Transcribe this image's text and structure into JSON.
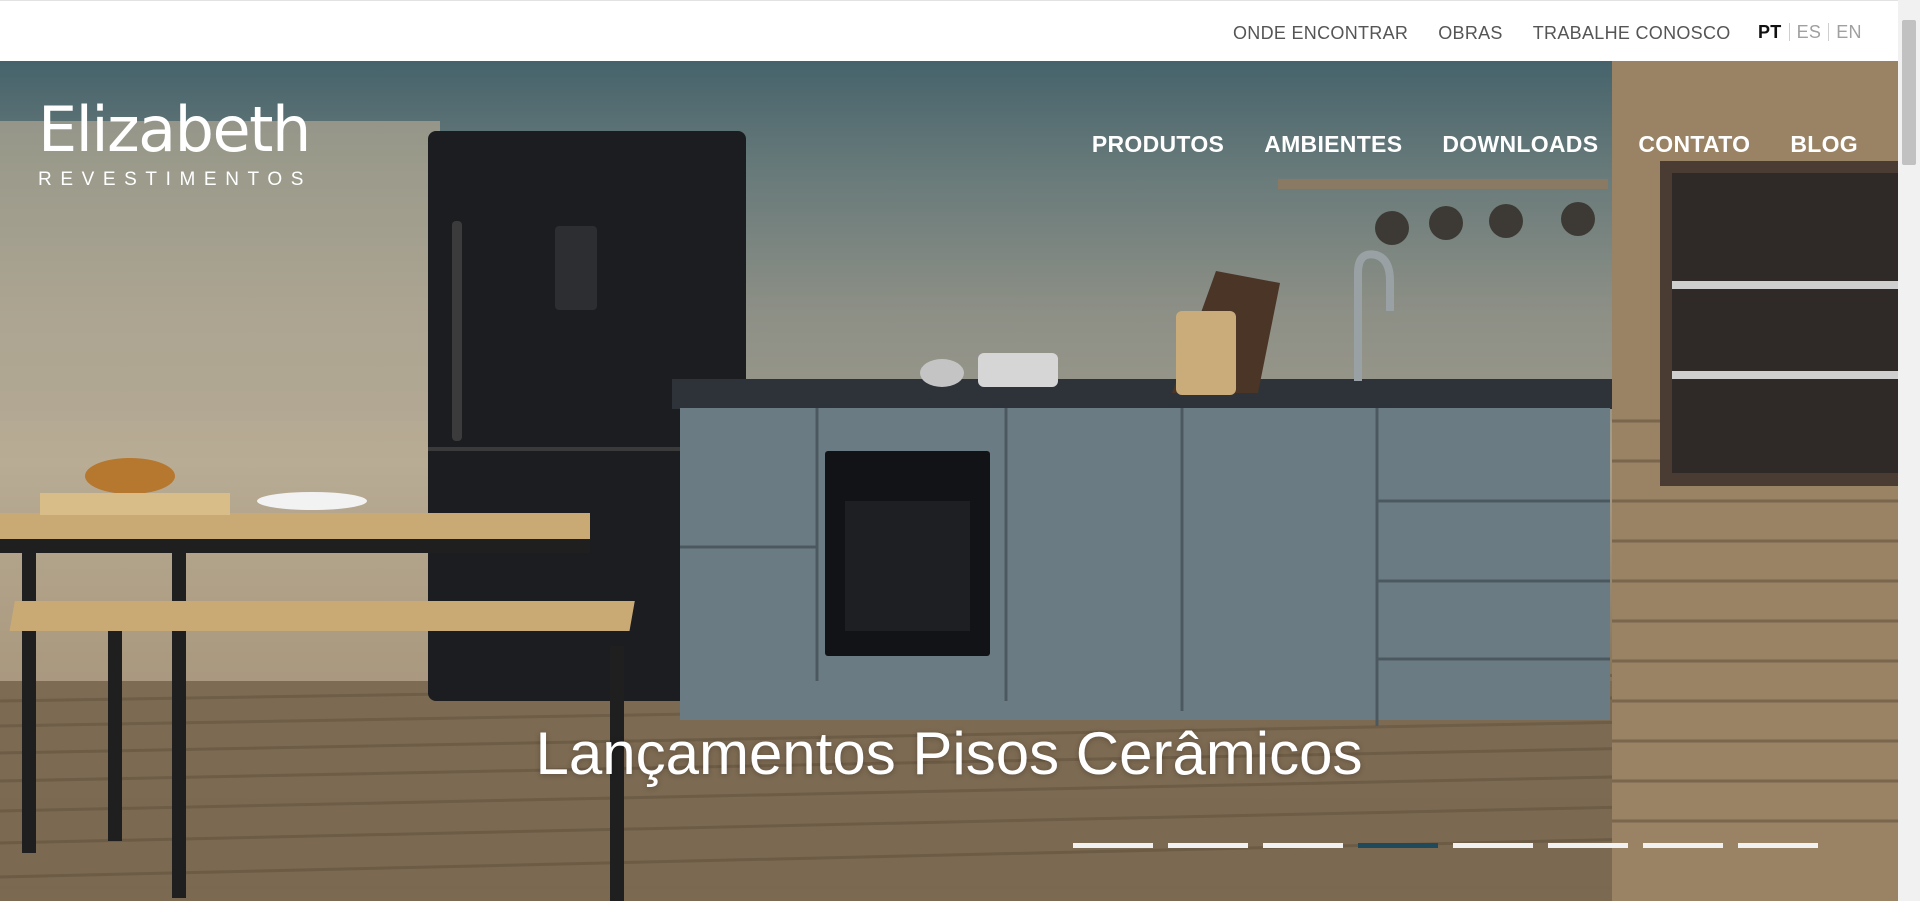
{
  "utility_nav": {
    "links": [
      "ONDE ENCONTRAR",
      "OBRAS",
      "TRABALHE CONOSCO"
    ],
    "languages": [
      "PT",
      "ES",
      "EN"
    ],
    "active_language": "PT"
  },
  "brand": {
    "name": "Elizabeth",
    "tagline": "REVESTIMENTOS"
  },
  "main_nav": [
    "PRODUTOS",
    "AMBIENTES",
    "DOWNLOADS",
    "CONTATO",
    "BLOG"
  ],
  "hero": {
    "headline": "Lançamentos Pisos Cerâmicos",
    "slide_count": 8,
    "active_slide": 4
  },
  "colors": {
    "brand_dark": "#1f4a5c",
    "text_light": "#ffffff"
  }
}
